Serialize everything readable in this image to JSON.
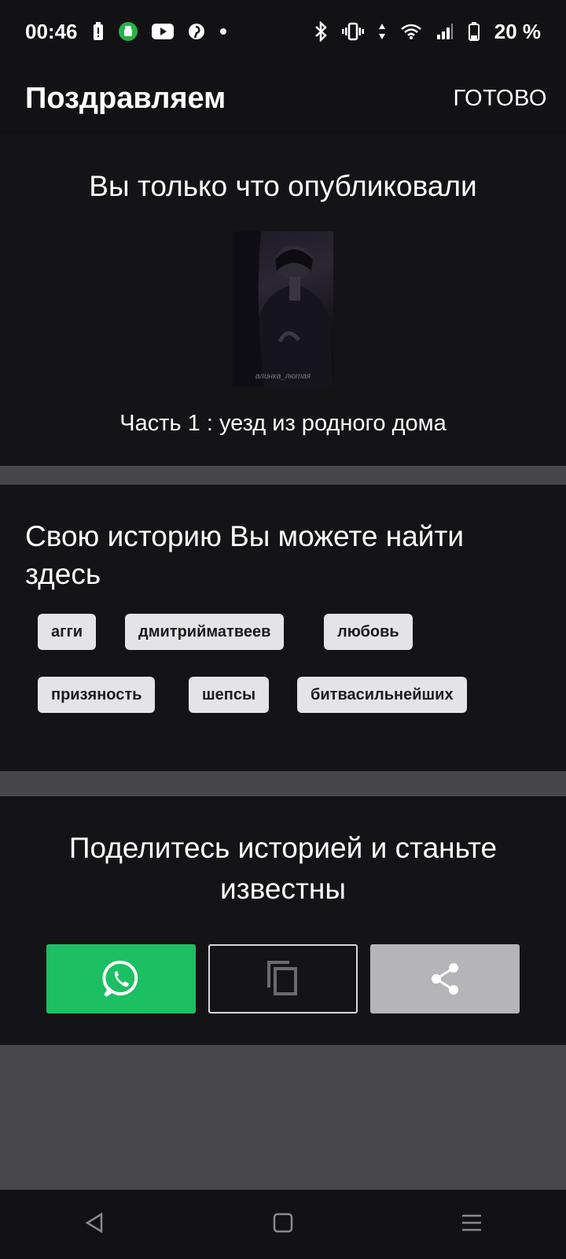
{
  "status_bar": {
    "time": "00:46",
    "battery_percent": "20 %",
    "left_icons": [
      "battery-alert-icon",
      "android-icon",
      "youtube-icon",
      "pinterest-icon",
      "dot-icon"
    ],
    "right_icons": [
      "bluetooth-icon",
      "vibrate-icon",
      "data-arrows-icon",
      "wifi-icon",
      "signal-icon",
      "battery-icon"
    ]
  },
  "header": {
    "title": "Поздравляем",
    "done_label": "ГОТОВО"
  },
  "published": {
    "headline": "Вы только что опубликовали",
    "cover_watermark": "алинка_лютая",
    "part_title": "Часть 1 : уезд из родного дома"
  },
  "find_story": {
    "headline": "Свою историю Вы можете найти здесь",
    "tags": [
      "агги",
      "дмитрийматвеев",
      "любовь",
      "призяность",
      "шепсы",
      "битвасильнейших"
    ]
  },
  "share": {
    "headline": "Поделитесь историей и станьте известны",
    "buttons": [
      "whatsapp-icon",
      "copy-icon",
      "share-icon"
    ]
  },
  "colors": {
    "background": "#141316",
    "divider": "#47464b",
    "whatsapp": "#1dbf63",
    "tag_bg": "#e4e4e7",
    "share_gray": "#b5b4b8"
  },
  "nav_bar": {
    "icons": [
      "back-icon",
      "home-icon",
      "recents-icon"
    ]
  }
}
